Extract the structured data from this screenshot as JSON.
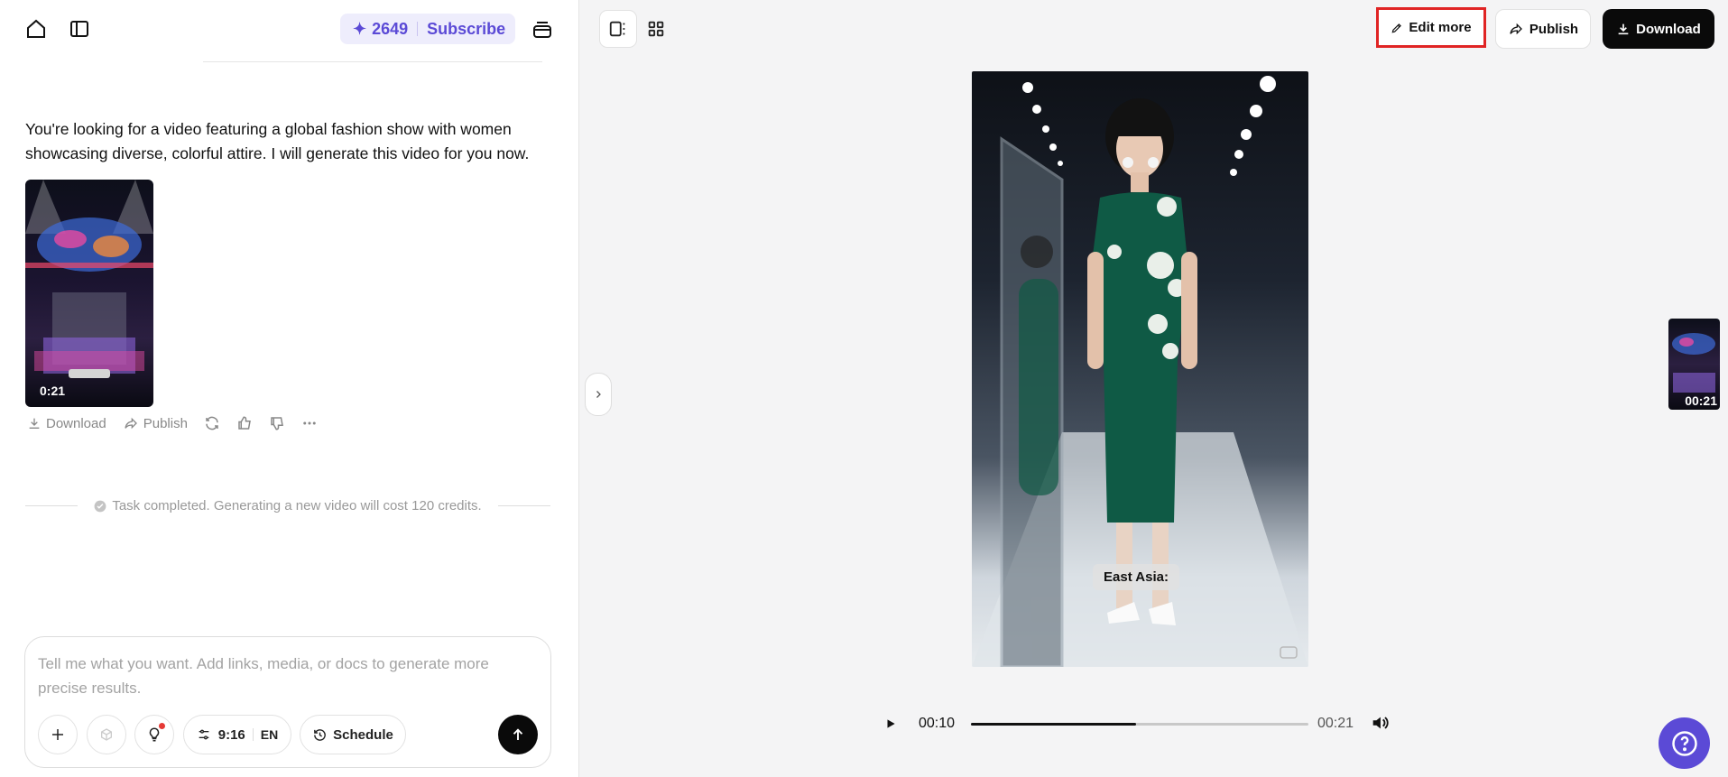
{
  "header": {
    "credits": "2649",
    "subscribe_label": "Subscribe"
  },
  "chat": {
    "assistant_message": "You're looking for a video featuring a global fashion show with women showcasing diverse, colorful attire. I will generate this video for you now.",
    "thumbnail_duration": "0:21",
    "actions": {
      "download_label": "Download",
      "publish_label": "Publish"
    },
    "status_text": "Task completed. Generating a new video will cost 120 credits."
  },
  "composer": {
    "placeholder": "Tell me what you want. Add links, media, or docs to generate more precise results.",
    "aspect_ratio": "9:16",
    "language": "EN",
    "schedule_label": "Schedule"
  },
  "toolbar": {
    "edit_more_label": "Edit more",
    "publish_label": "Publish",
    "download_label": "Download"
  },
  "video": {
    "subtitle": "East Asia:",
    "current_time": "00:10",
    "duration": "00:21",
    "progress_fraction": 0.49,
    "side_thumbnail_duration": "00:21"
  },
  "colors": {
    "accent": "#5b4ad6",
    "highlight_border": "#e02424",
    "dress": "#0f5a45"
  }
}
